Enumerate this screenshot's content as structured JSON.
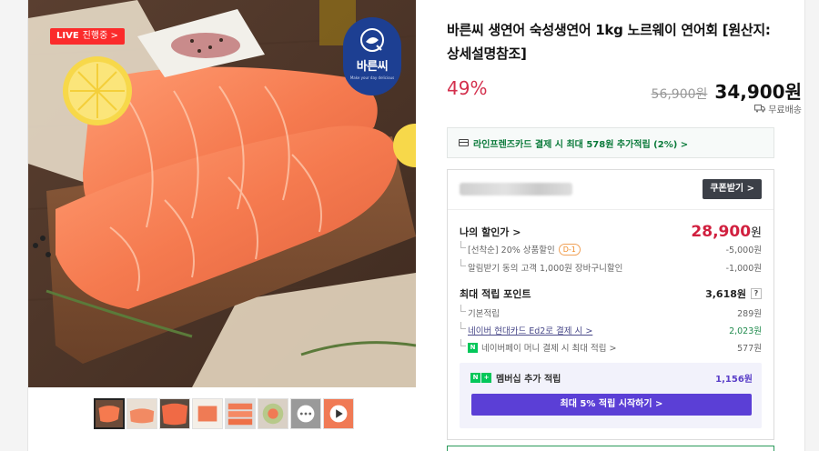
{
  "product": {
    "title": "바른씨 생연어 숙성생연어 1kg 노르웨이 연어회 [원산지:상세설명참조]",
    "discount_rate": "49%",
    "original_price": "56,900원",
    "sale_price": "34,900원",
    "shipping": "무료배송"
  },
  "image_overlay": {
    "live_word": "LIVE",
    "live_status": "진행중 >",
    "brand_name": "바른씨",
    "brand_tagline": "Make your day delicious"
  },
  "thumbnails": [
    {
      "name": "thumb-1",
      "active": true
    },
    {
      "name": "thumb-2",
      "active": false
    },
    {
      "name": "thumb-3",
      "active": false
    },
    {
      "name": "thumb-4",
      "active": false
    },
    {
      "name": "thumb-5",
      "active": false
    },
    {
      "name": "thumb-6",
      "active": false
    },
    {
      "name": "thumb-7",
      "active": false
    },
    {
      "name": "thumb-8",
      "active": false
    }
  ],
  "card_promo": "라인프렌즈카드 결제 시 최대 578원 추가적립 (2%) >",
  "benefits": {
    "coupon_button": "쿠폰받기 >",
    "my_discount_label": "나의 할인가 >",
    "my_discount_value": "28,900",
    "my_discount_unit": "원",
    "line1_label": "[선착순] 20% 상품할인",
    "line1_badge": "D-1",
    "line1_value": "-5,000원",
    "line2_label": "알림받기 동의 고객 1,000원 장바구니할인",
    "line2_value": "-1,000원",
    "points_label": "최대 적립 포인트",
    "points_value": "3,618원",
    "points_help": "?",
    "p1_label": "기본적립",
    "p1_value": "289원",
    "p2_label": "네이버 현대카드 Ed2로 결제 시 >",
    "p2_value": "2,023원",
    "p3_icon": "N",
    "p3_label": "네이버페이 머니 결제 시 최대 적립 >",
    "p3_value": "577원",
    "membership_icon_n": "N",
    "membership_icon_plus": "+",
    "membership_label": "멤버십 추가 적립",
    "membership_value": "1,156원",
    "membership_button": "최대 5% 적립 시작하기 >"
  },
  "colors": {
    "discount_red": "#d32f4c",
    "naver_green": "#03c75a",
    "membership_purple": "#5b3fd6",
    "brand_blue": "#1d3f92"
  }
}
